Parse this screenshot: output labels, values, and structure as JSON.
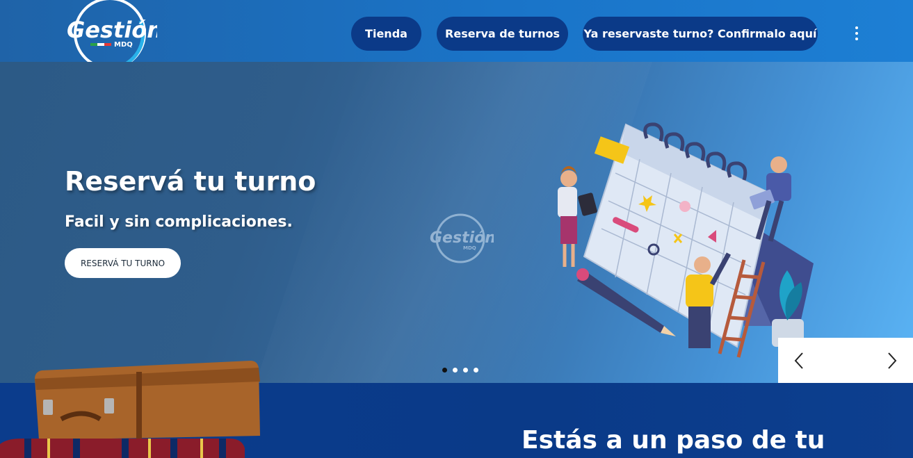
{
  "header": {
    "logo_text": "Gestión",
    "logo_subtext": "MDQ",
    "nav": [
      {
        "label": "Tienda"
      },
      {
        "label": "Reserva de turnos"
      },
      {
        "label": "Ya reservaste turno? Confirmalo aquí"
      }
    ],
    "menu_icon": "kebab-menu-icon"
  },
  "hero": {
    "title": "Reservá tu turno",
    "subtitle": "Facil y sin complicaciones.",
    "cta_label": "RESERVÁ TU TURNO",
    "watermark_text": "Gestión",
    "watermark_subtext": "MDQ",
    "slides_count": 4,
    "active_slide": 1,
    "prev_icon": "chevron-left-icon",
    "next_icon": "chevron-right-icon"
  },
  "section": {
    "title": "Estás a un paso de tu"
  },
  "colors": {
    "header_bg": "#1a74c8",
    "nav_button_bg": "#0b3a88",
    "section_bg": "#0a3a88",
    "accent_light": "#1fa7e8"
  }
}
